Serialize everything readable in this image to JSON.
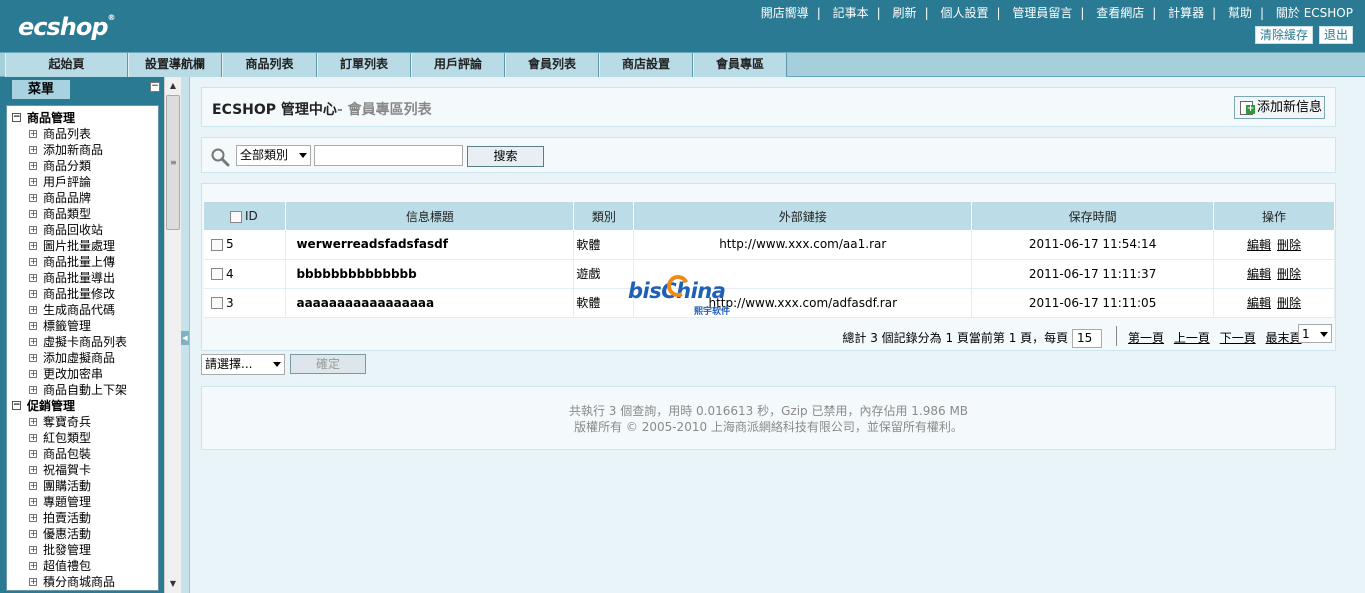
{
  "header": {
    "logo": "ecshop",
    "links": [
      "開店嚮導",
      "記事本",
      "刷新",
      "個人設置",
      "管理員留言",
      "查看網店",
      "計算器",
      "幫助",
      "關於 ECSHOP"
    ],
    "clear_cache": "清除緩存",
    "logout": "退出"
  },
  "nav": {
    "items": [
      "起始頁",
      "設置導航欄",
      "商品列表",
      "訂單列表",
      "用戶評論",
      "會員列表",
      "商店設置",
      "會員專區"
    ]
  },
  "sidebar": {
    "tab": "菜單",
    "groups": [
      {
        "label": "商品管理",
        "items": [
          "商品列表",
          "添加新商品",
          "商品分類",
          "用戶評論",
          "商品品牌",
          "商品類型",
          "商品回收站",
          "圖片批量處理",
          "商品批量上傳",
          "商品批量導出",
          "商品批量修改",
          "生成商品代碼",
          "標籤管理",
          "虛擬卡商品列表",
          "添加虛擬商品",
          "更改加密串",
          "商品自動上下架"
        ]
      },
      {
        "label": "促銷管理",
        "items": [
          "奪寶奇兵",
          "紅包類型",
          "商品包裝",
          "祝福賀卡",
          "團購活動",
          "專題管理",
          "拍賣活動",
          "優惠活動",
          "批發管理",
          "超值禮包",
          "積分商城商品"
        ]
      }
    ]
  },
  "page": {
    "title": "ECSHOP 管理中心",
    "subtitle": "- 會員專區列表",
    "add_button": "添加新信息"
  },
  "search": {
    "category_selected": "全部類別",
    "keyword": "",
    "button": "搜索"
  },
  "table": {
    "headers": [
      "ID",
      "信息標題",
      "類別",
      "外部鏈接",
      "保存時間",
      "操作"
    ],
    "rows": [
      {
        "id": "5",
        "title": "werwerreadsfadsfasdf",
        "category": "軟體",
        "link": "http://www.xxx.com/aa1.rar",
        "time": "2011-06-17 11:54:14"
      },
      {
        "id": "4",
        "title": "bbbbbbbbbbbbbb",
        "category": "遊戲",
        "link": "",
        "time": "2011-06-17 11:11:37"
      },
      {
        "id": "3",
        "title": "aaaaaaaaaaaaaaaaa",
        "category": "軟體",
        "link": "http://www.xxx.com/adfasdf.rar",
        "time": "2011-06-17 11:11:05"
      }
    ],
    "edit_label": "編輯",
    "delete_label": "刪除"
  },
  "pager": {
    "info": "總計  3 個記錄分為  1 頁當前第  1 頁，每頁",
    "per_page": "15",
    "first": "第一頁",
    "prev": "上一頁",
    "next": "下一頁",
    "last": "最末頁",
    "page_select": "1"
  },
  "batch": {
    "select": "請選擇...",
    "confirm": "確定"
  },
  "footer": {
    "line1": "共執行  3 個查詢，用時  0.016613 秒，Gzip 已禁用，內存佔用  1.986 MB",
    "line2": "版權所有 © 2005-2010 上海商派網絡科技有限公司，並保留所有權利。"
  },
  "watermark": {
    "brand": "bisChina",
    "cn": "熙宇软件"
  },
  "colors": {
    "header_bg": "#2a7a93",
    "nav_bg": "#b9dbe6",
    "table_header_bg": "#bcdde7",
    "page_bg": "#e9f4f8"
  },
  "icons": [
    "search-icon",
    "add-document-icon",
    "tree-expand-icon",
    "tree-collapse-icon",
    "dropdown-arrow-icon"
  ]
}
